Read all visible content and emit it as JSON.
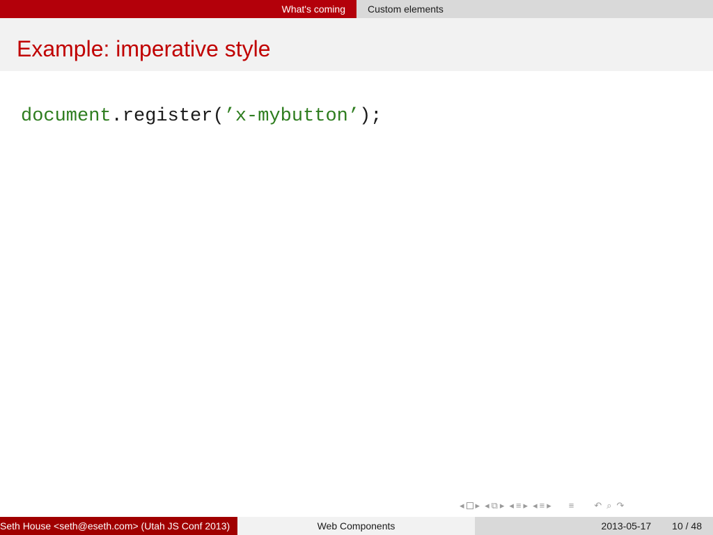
{
  "nav": {
    "section_active": "What's coming",
    "section_current": "Custom elements"
  },
  "slide": {
    "title": "Example: imperative style",
    "code": {
      "object": "document",
      "dot": ".",
      "method": "register(",
      "string": "’x-mybutton’",
      "closing": ");"
    }
  },
  "footer": {
    "author": "Seth House <seth@eseth.com>  (Utah JS Conf 2013)",
    "title": "Web Components",
    "date": "2013-05-17",
    "page": "10 / 48"
  },
  "colors": {
    "accent": "#b3000a",
    "title": "#c00000",
    "code_keyword": "#2e7d1f"
  },
  "icons": [
    "arrow-left-icon",
    "frame-icon",
    "arrow-right-icon",
    "subsection-icon",
    "section-icon",
    "align-icon",
    "undo-icon",
    "search-icon",
    "redo-icon"
  ]
}
